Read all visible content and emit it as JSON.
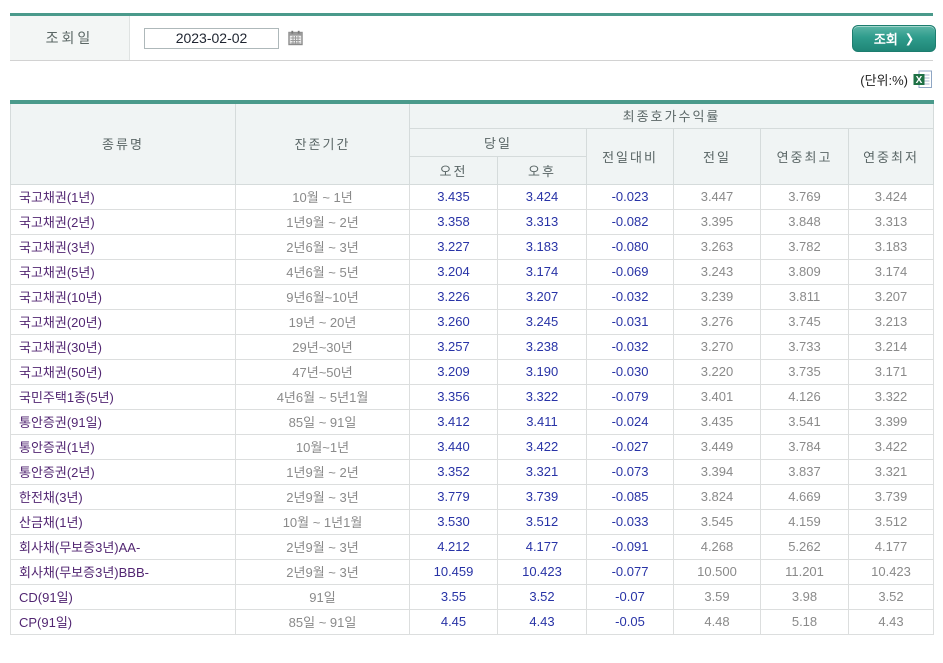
{
  "colors": {
    "accent_teal": "#4A9A8B",
    "button_teal": "#2F9C8C",
    "type_purple": "#522672",
    "value_blue": "#2833A6",
    "value_gray": "#8A8A8A",
    "header_bg": "#F0F4F4"
  },
  "toolbar": {
    "date_label": "조회일",
    "date_value": "2023-02-02",
    "search_button_label": "조회",
    "search_button_arrow": "❯"
  },
  "unit_note": "(단위:%)",
  "table": {
    "headers": {
      "col_type": "종류명",
      "col_period": "잔존기간",
      "group_yield": "최종호가수익률",
      "group_today": "당일",
      "col_am": "오전",
      "col_pm": "오후",
      "col_change": "전일대비",
      "col_prev": "전일",
      "col_high": "연중최고",
      "col_low": "연중최저"
    },
    "rows": [
      {
        "type": "국고채권(1년)",
        "period": "10월 ~ 1년",
        "am": "3.435",
        "pm": "3.424",
        "change": "-0.023",
        "prev": "3.447",
        "high": "3.769",
        "low": "3.424"
      },
      {
        "type": "국고채권(2년)",
        "period": "1년9월 ~ 2년",
        "am": "3.358",
        "pm": "3.313",
        "change": "-0.082",
        "prev": "3.395",
        "high": "3.848",
        "low": "3.313"
      },
      {
        "type": "국고채권(3년)",
        "period": "2년6월 ~ 3년",
        "am": "3.227",
        "pm": "3.183",
        "change": "-0.080",
        "prev": "3.263",
        "high": "3.782",
        "low": "3.183"
      },
      {
        "type": "국고채권(5년)",
        "period": "4년6월 ~ 5년",
        "am": "3.204",
        "pm": "3.174",
        "change": "-0.069",
        "prev": "3.243",
        "high": "3.809",
        "low": "3.174"
      },
      {
        "type": "국고채권(10년)",
        "period": "9년6월~10년",
        "am": "3.226",
        "pm": "3.207",
        "change": "-0.032",
        "prev": "3.239",
        "high": "3.811",
        "low": "3.207"
      },
      {
        "type": "국고채권(20년)",
        "period": "19년 ~ 20년",
        "am": "3.260",
        "pm": "3.245",
        "change": "-0.031",
        "prev": "3.276",
        "high": "3.745",
        "low": "3.213"
      },
      {
        "type": "국고채권(30년)",
        "period": "29년~30년",
        "am": "3.257",
        "pm": "3.238",
        "change": "-0.032",
        "prev": "3.270",
        "high": "3.733",
        "low": "3.214"
      },
      {
        "type": "국고채권(50년)",
        "period": "47년~50년",
        "am": "3.209",
        "pm": "3.190",
        "change": "-0.030",
        "prev": "3.220",
        "high": "3.735",
        "low": "3.171"
      },
      {
        "type": "국민주택1종(5년)",
        "period": "4년6월 ~ 5년1월",
        "am": "3.356",
        "pm": "3.322",
        "change": "-0.079",
        "prev": "3.401",
        "high": "4.126",
        "low": "3.322"
      },
      {
        "type": "통안증권(91일)",
        "period": "85일 ~ 91일",
        "am": "3.412",
        "pm": "3.411",
        "change": "-0.024",
        "prev": "3.435",
        "high": "3.541",
        "low": "3.399"
      },
      {
        "type": "통안증권(1년)",
        "period": "10월~1년",
        "am": "3.440",
        "pm": "3.422",
        "change": "-0.027",
        "prev": "3.449",
        "high": "3.784",
        "low": "3.422"
      },
      {
        "type": "통안증권(2년)",
        "period": "1년9월 ~ 2년",
        "am": "3.352",
        "pm": "3.321",
        "change": "-0.073",
        "prev": "3.394",
        "high": "3.837",
        "low": "3.321"
      },
      {
        "type": "한전채(3년)",
        "period": "2년9월 ~ 3년",
        "am": "3.779",
        "pm": "3.739",
        "change": "-0.085",
        "prev": "3.824",
        "high": "4.669",
        "low": "3.739"
      },
      {
        "type": "산금채(1년)",
        "period": "10월 ~ 1년1월",
        "am": "3.530",
        "pm": "3.512",
        "change": "-0.033",
        "prev": "3.545",
        "high": "4.159",
        "low": "3.512"
      },
      {
        "type": "회사채(무보증3년)AA-",
        "period": "2년9월 ~ 3년",
        "am": "4.212",
        "pm": "4.177",
        "change": "-0.091",
        "prev": "4.268",
        "high": "5.262",
        "low": "4.177"
      },
      {
        "type": "회사채(무보증3년)BBB-",
        "period": "2년9월 ~ 3년",
        "am": "10.459",
        "pm": "10.423",
        "change": "-0.077",
        "prev": "10.500",
        "high": "11.201",
        "low": "10.423"
      },
      {
        "type": "CD(91일)",
        "period": "91일",
        "am": "3.55",
        "pm": "3.52",
        "change": "-0.07",
        "prev": "3.59",
        "high": "3.98",
        "low": "3.52"
      },
      {
        "type": "CP(91일)",
        "period": "85일 ~ 91일",
        "am": "4.45",
        "pm": "4.43",
        "change": "-0.05",
        "prev": "4.48",
        "high": "5.18",
        "low": "4.43"
      }
    ]
  }
}
